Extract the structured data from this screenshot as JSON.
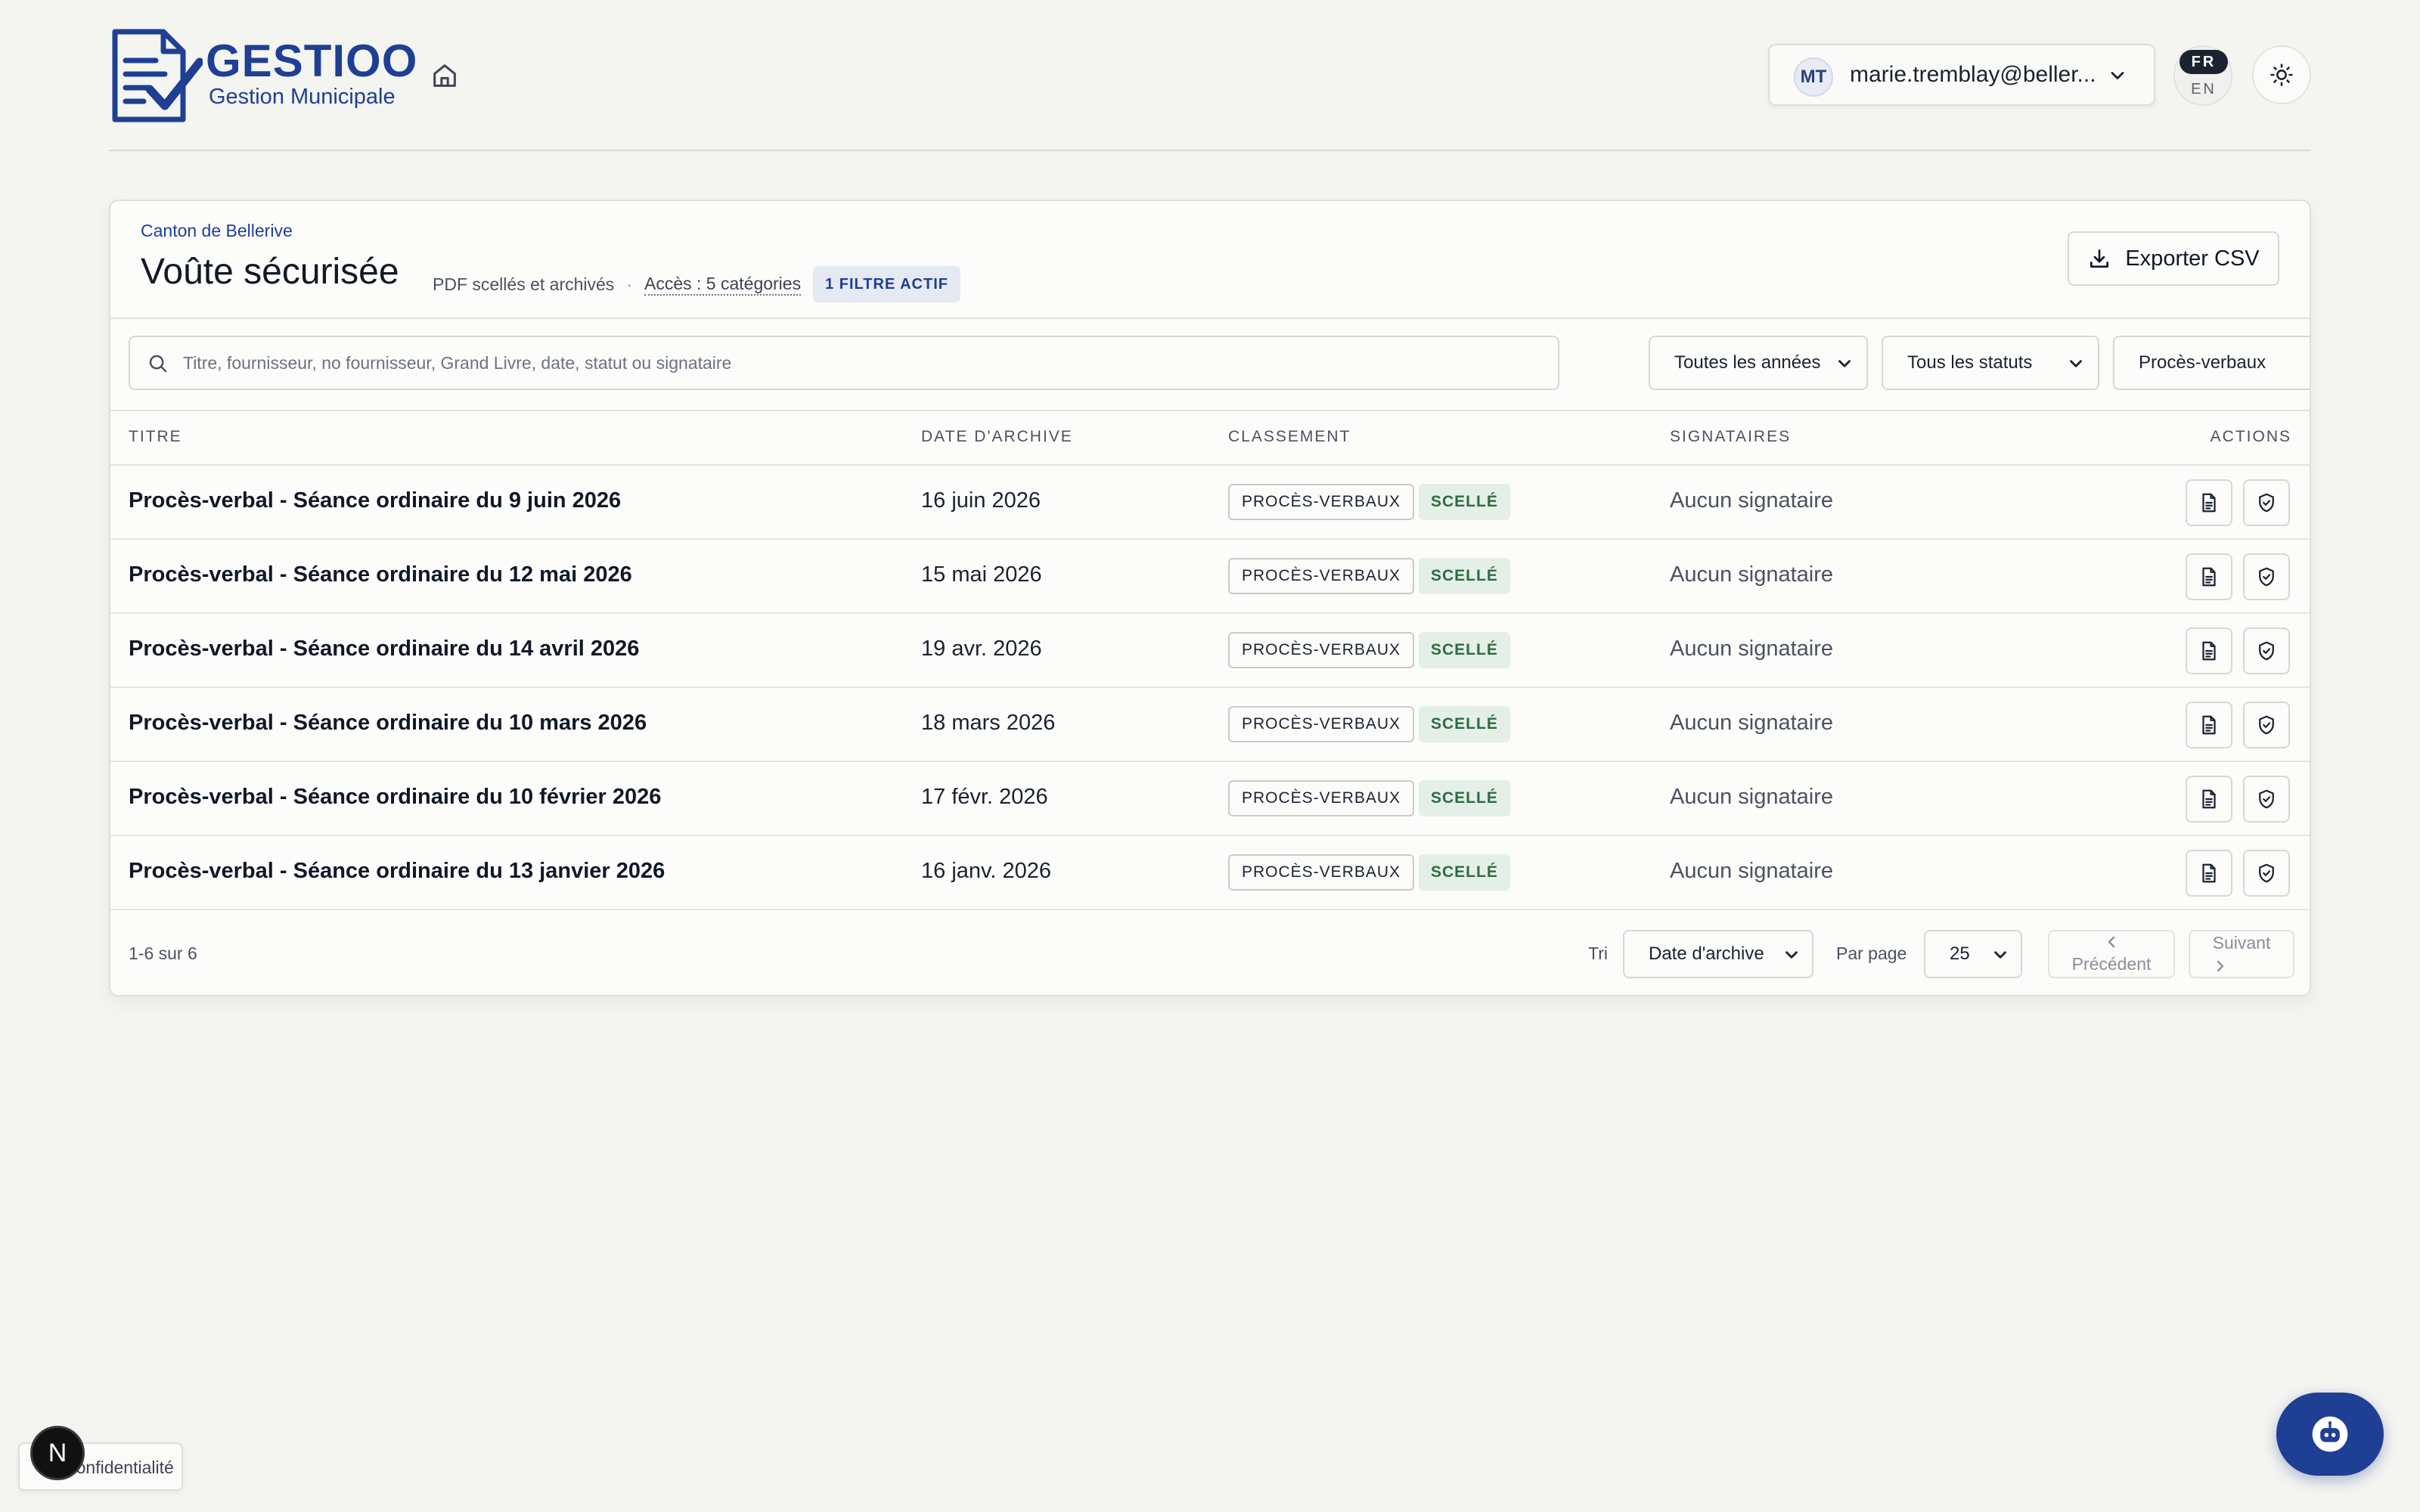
{
  "header": {
    "brand_name": "GESTIOO",
    "brand_sub": "Gestion Municipale",
    "user": {
      "initials": "MT",
      "email": "marie.tremblay@beller..."
    },
    "lang": {
      "active": "FR",
      "other": "EN"
    }
  },
  "vault": {
    "breadcrumb": "Canton de Bellerive",
    "title": "Voûte sécurisée",
    "subtitle": "PDF scellés et archivés",
    "separator": "·",
    "access": "Accès : 5 catégories",
    "filter_badge": "1 FILTRE ACTIF",
    "export_label": "Exporter CSV"
  },
  "filters": {
    "search_placeholder": "Titre, fournisseur, no fournisseur, Grand Livre, date, statut ou signataire",
    "year": "Toutes les années",
    "status": "Tous les statuts",
    "category": "Procès-verbaux"
  },
  "table": {
    "columns": {
      "title": "TITRE",
      "date": "DATE D'ARCHIVE",
      "classement": "CLASSEMENT",
      "signataires": "SIGNATAIRES",
      "actions": "ACTIONS"
    },
    "rows": [
      {
        "title": "Procès-verbal - Séance ordinaire du 9 juin 2026",
        "date": "16 juin 2026",
        "category": "PROCÈS-VERBAUX",
        "status": "SCELLÉ",
        "signers": "Aucun signataire"
      },
      {
        "title": "Procès-verbal - Séance ordinaire du 12 mai 2026",
        "date": "15 mai 2026",
        "category": "PROCÈS-VERBAUX",
        "status": "SCELLÉ",
        "signers": "Aucun signataire"
      },
      {
        "title": "Procès-verbal - Séance ordinaire du 14 avril 2026",
        "date": "19 avr. 2026",
        "category": "PROCÈS-VERBAUX",
        "status": "SCELLÉ",
        "signers": "Aucun signataire"
      },
      {
        "title": "Procès-verbal - Séance ordinaire du 10 mars 2026",
        "date": "18 mars 2026",
        "category": "PROCÈS-VERBAUX",
        "status": "SCELLÉ",
        "signers": "Aucun signataire"
      },
      {
        "title": "Procès-verbal - Séance ordinaire du 10 février 2026",
        "date": "17 févr. 2026",
        "category": "PROCÈS-VERBAUX",
        "status": "SCELLÉ",
        "signers": "Aucun signataire"
      },
      {
        "title": "Procès-verbal - Séance ordinaire du 13 janvier 2026",
        "date": "16 janv. 2026",
        "category": "PROCÈS-VERBAUX",
        "status": "SCELLÉ",
        "signers": "Aucun signataire"
      }
    ]
  },
  "footer": {
    "range": "1-6 sur 6",
    "sort_label": "Tri",
    "sort_value": "Date d'archive",
    "per_page_label": "Par page",
    "per_page_value": "25",
    "prev": "Précédent",
    "next": "Suivant"
  },
  "privacy_label": "Confidentialité",
  "next_badge": "N",
  "icons": {
    "home": "home-icon",
    "chevron": "chevron-down-icon",
    "theme": "sun-icon",
    "export": "download-icon",
    "search": "search-icon",
    "row_document": "document-icon",
    "row_verify": "shield-check-icon",
    "assistant": "robot-icon"
  },
  "colors": {
    "brand": "#1e3f93",
    "sealed_bg": "#e4efe7",
    "sealed_text": "#2d6b45",
    "background": "#f4f4f1"
  }
}
